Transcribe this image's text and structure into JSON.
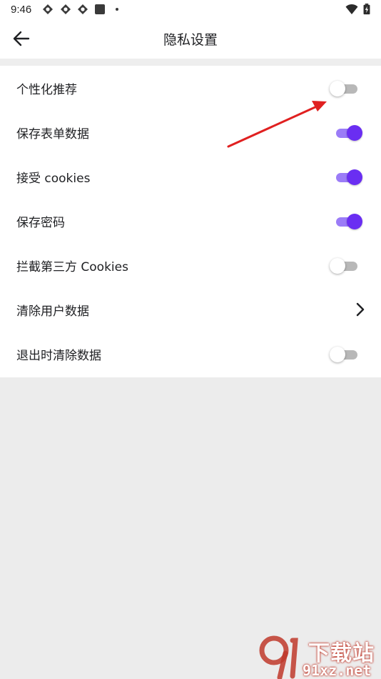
{
  "status_bar": {
    "time": "9:46",
    "icons": [
      "app-icon",
      "app-icon",
      "app-icon",
      "gallery-icon",
      "dot-icon",
      "wifi-icon",
      "battery-charging-icon"
    ]
  },
  "app_bar": {
    "title": "隐私设置",
    "back_icon": "arrow-left-icon"
  },
  "settings": {
    "items": [
      {
        "label": "个性化推荐",
        "control": "toggle",
        "checked": false
      },
      {
        "label": "保存表单数据",
        "control": "toggle",
        "checked": true
      },
      {
        "label": "接受 cookies",
        "control": "toggle",
        "checked": true
      },
      {
        "label": "保存密码",
        "control": "toggle",
        "checked": true
      },
      {
        "label": "拦截第三方 Cookies",
        "control": "toggle",
        "checked": false
      },
      {
        "label": "清除用户数据",
        "control": "chevron-right-icon"
      },
      {
        "label": "退出时清除数据",
        "control": "toggle",
        "checked": false
      }
    ]
  },
  "colors": {
    "accent": "#6a2ef2",
    "accent_track": "#9b7cf7",
    "annotation": "#e02020",
    "page_background": "#ececec"
  },
  "watermark": {
    "title": "下载站",
    "url": "91xz.net"
  }
}
